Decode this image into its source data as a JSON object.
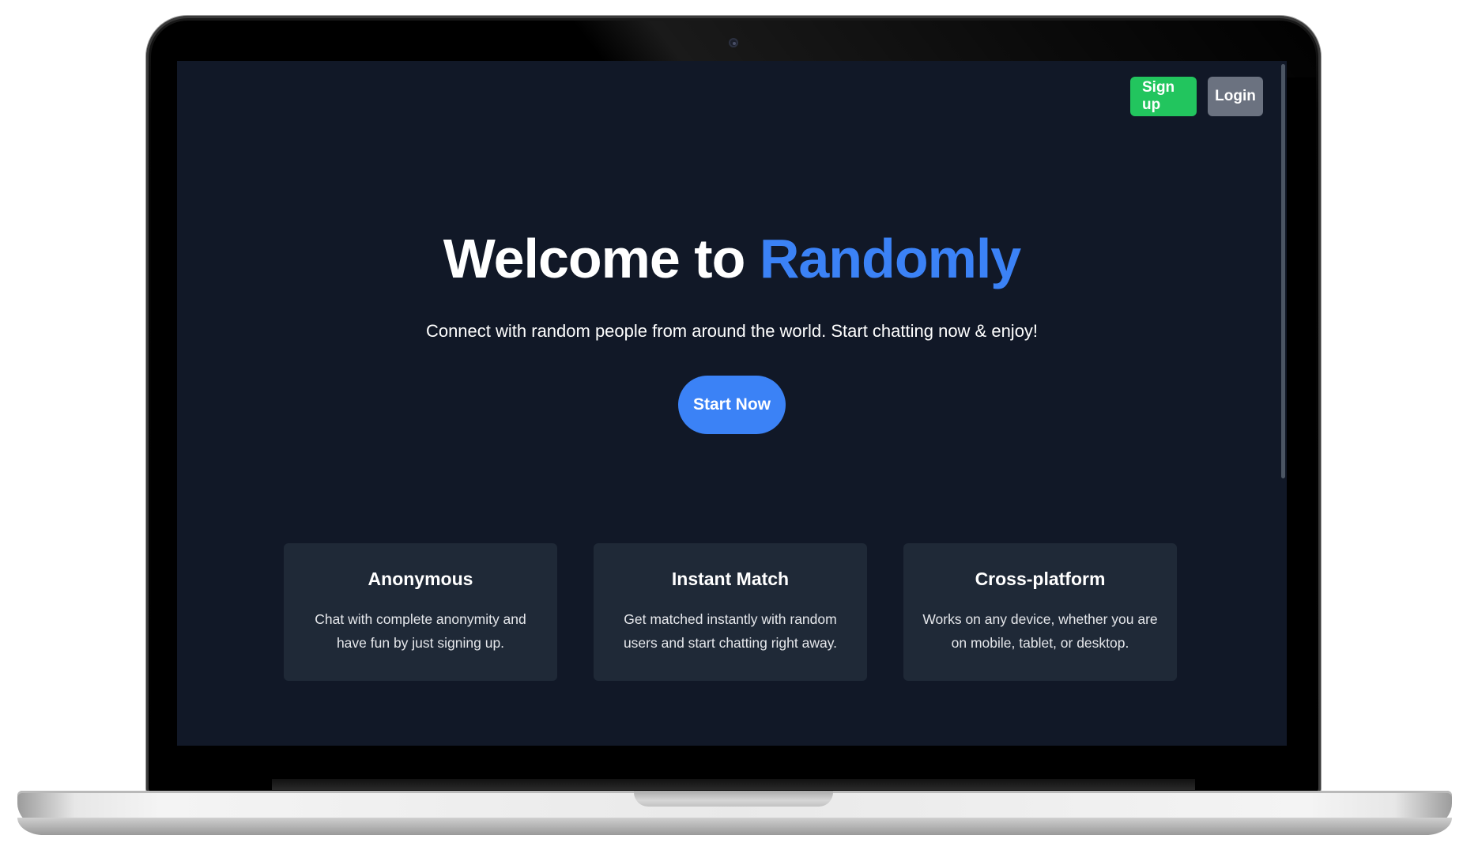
{
  "nav": {
    "signup_label": "Sign up",
    "login_label": "Login"
  },
  "hero": {
    "title_prefix": "Welcome to ",
    "title_brand": "Randomly",
    "subtitle": "Connect with random people from around the world. Start chatting now & enjoy!",
    "cta_label": "Start Now"
  },
  "features": [
    {
      "title": "Anonymous",
      "description": "Chat with complete anonymity and have fun by just signing up."
    },
    {
      "title": "Instant Match",
      "description": "Get matched instantly with random users and start chatting right away."
    },
    {
      "title": "Cross-platform",
      "description": "Works on any device, whether you are on mobile, tablet, or desktop."
    }
  ],
  "colors": {
    "background": "#111827",
    "card": "#1f2937",
    "accent": "#3b82f6",
    "signup": "#22c55e",
    "login": "#6b7280"
  }
}
